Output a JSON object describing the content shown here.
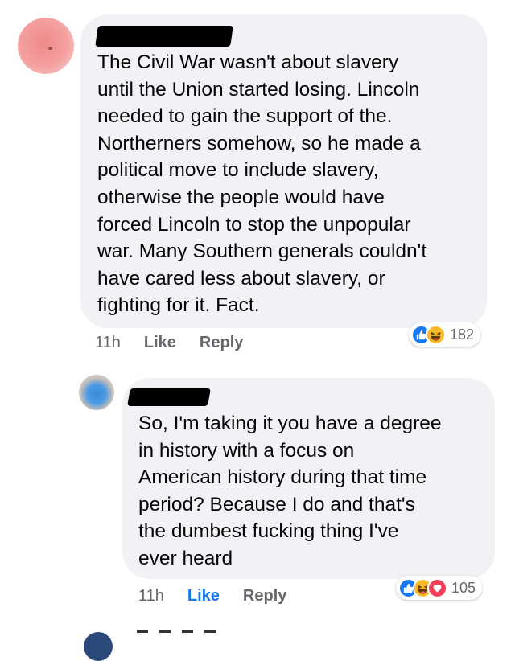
{
  "comments": [
    {
      "text": "The Civil War wasn't about slavery\nuntil the Union started losing. Lincoln\nneeded to gain the support of the.\nNortherners somehow, so he made a\npolitical move to include slavery,\notherwise the people would have\nforced Lincoln to stop the unpopular\nwar. Many Southern generals couldn't\nhave cared less about slavery, or\nfighting for it. Fact.",
      "time": "11h",
      "like_label": "Like",
      "reply_label": "Reply",
      "like_active": false,
      "reactions": [
        "like-icon",
        "haha-icon"
      ],
      "reaction_count": "182"
    },
    {
      "text": "So, I'm taking it you have a degree\nin history with a focus on\nAmerican history during that time\nperiod? Because I do and that's\nthe dumbest fucking thing I've\never heard",
      "time": "11h",
      "like_label": "Like",
      "reply_label": "Reply",
      "like_active": true,
      "reactions": [
        "like-icon",
        "haha-icon",
        "love-icon"
      ],
      "reaction_count": "105"
    }
  ],
  "colors": {
    "bubble": "#f0f2f5",
    "meta_text": "#65676b",
    "link_blue": "#1877f2",
    "like_reaction": "#1877f2",
    "haha_reaction": "#f7b928",
    "love_reaction": "#f33e58"
  }
}
